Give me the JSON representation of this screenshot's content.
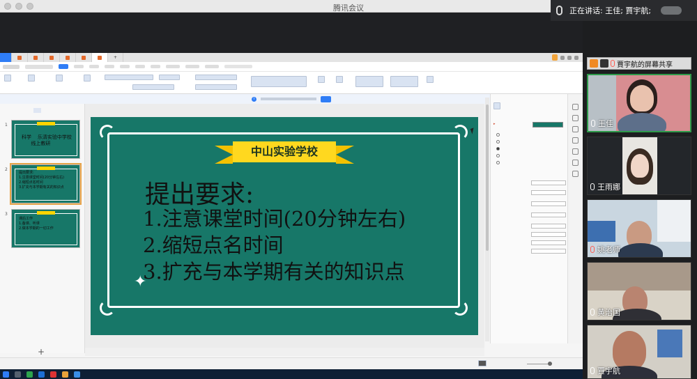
{
  "window": {
    "title": "腾讯会议"
  },
  "meeting": {
    "speaking_label": "正在讲话: 王佳; 賈宇航;",
    "share_label": "賈宇航的屏幕共享",
    "participants": [
      {
        "name": "王佳",
        "mic": "on",
        "active": true
      },
      {
        "name": "王雨娜",
        "mic": "on"
      },
      {
        "name": "姚老师",
        "mic": "muted"
      },
      {
        "name": "黄治国",
        "mic": "on"
      },
      {
        "name": "賈宇航",
        "mic": "on"
      }
    ]
  },
  "slide": {
    "banner": "中山实验学校",
    "title": "提出要求:",
    "lines": [
      "1.注意课堂时间(20分钟左右)",
      "2.缩短点名时间",
      "3.扩充与本学期有关的知识点"
    ],
    "bg_color": "#177768",
    "banner_color": "#ffd81f"
  },
  "thumbnails": [
    {
      "num": "1",
      "text": "科学    乐清实验中学校\n      线上教研",
      "selected": false
    },
    {
      "num": "2",
      "text": "提出要求:\n1.注意课堂时间(20分钟左右)\n2.缩短点名时间\n3.扩充与本学期有关的知识点",
      "selected": true
    },
    {
      "num": "3",
      "text": "课后工作\n1.备课、听课\n2.做本学期的一切工作",
      "selected": false
    }
  ]
}
